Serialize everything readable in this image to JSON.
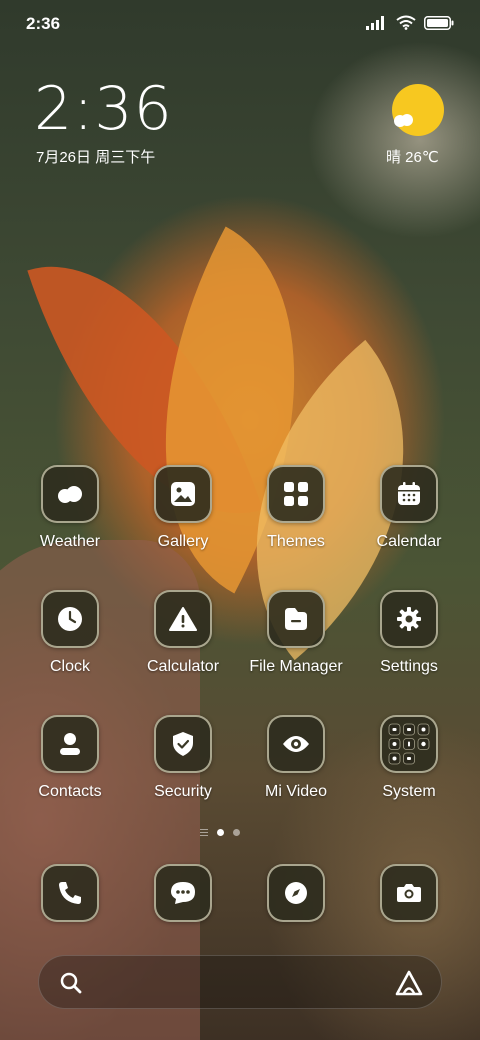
{
  "status_bar": {
    "time": "2:36"
  },
  "lock_widget": {
    "clock": "2:36",
    "date": "7月26日 周三下午"
  },
  "weather_widget": {
    "text": "晴 26℃",
    "sun_color": "#f7c820"
  },
  "apps": [
    {
      "label": "Weather",
      "icon": "cloud-icon"
    },
    {
      "label": "Gallery",
      "icon": "image-icon"
    },
    {
      "label": "Themes",
      "icon": "grid-icon"
    },
    {
      "label": "Calendar",
      "icon": "calendar-icon"
    },
    {
      "label": "Clock",
      "icon": "clock-icon"
    },
    {
      "label": "Calculator",
      "icon": "warning-icon"
    },
    {
      "label": "File Manager",
      "icon": "folder-icon"
    },
    {
      "label": "Settings",
      "icon": "gear-icon"
    },
    {
      "label": "Contacts",
      "icon": "person-icon"
    },
    {
      "label": "Security",
      "icon": "shield-check-icon"
    },
    {
      "label": "Mi Video",
      "icon": "eye-icon"
    },
    {
      "label": "System",
      "icon": "folder-grid-icon"
    }
  ],
  "page_indicator": {
    "pages": 3,
    "active_index": 1
  },
  "dock": [
    {
      "icon": "phone-icon"
    },
    {
      "icon": "message-icon"
    },
    {
      "icon": "compass-icon"
    },
    {
      "icon": "camera-icon"
    }
  ],
  "search": {
    "placeholder": ""
  },
  "colors": {
    "icon_bg": "#2e2c1e",
    "icon_border": "#d2cdb4"
  }
}
